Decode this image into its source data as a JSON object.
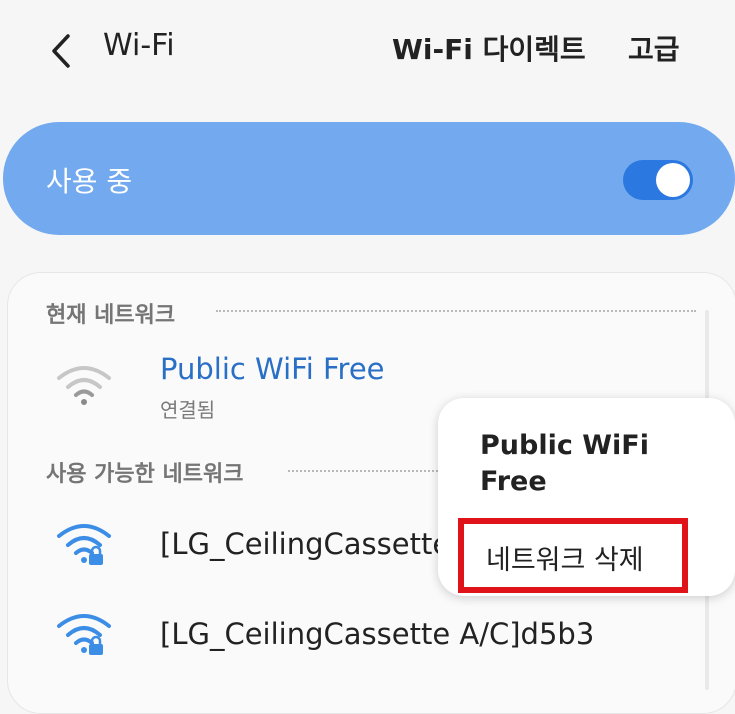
{
  "header": {
    "title": "Wi-Fi",
    "actions": [
      "Wi-Fi 다이렉트",
      "고급"
    ]
  },
  "master_switch": {
    "label": "사용 중",
    "on": true
  },
  "current_section": {
    "title": "현재 네트워크",
    "network": {
      "name": "Public WiFi Free",
      "status": "연결됨",
      "icon": "wifi-icon",
      "secured": false
    }
  },
  "available_section": {
    "title": "사용 가능한 네트워크",
    "networks": [
      {
        "name": "[LG_CeilingCassette",
        "icon": "wifi-lock-icon",
        "secured": true
      },
      {
        "name": "[LG_CeilingCassette A/C]d5b3",
        "icon": "wifi-lock-icon",
        "secured": true
      }
    ]
  },
  "context_menu": {
    "title": "Public WiFi Free",
    "items": [
      "네트워크 삭제"
    ]
  },
  "colors": {
    "accent": "#72a9ef",
    "toggle": "#2a78e0",
    "wifi_blue": "#3b8de6",
    "highlight_box": "#e0131a"
  }
}
